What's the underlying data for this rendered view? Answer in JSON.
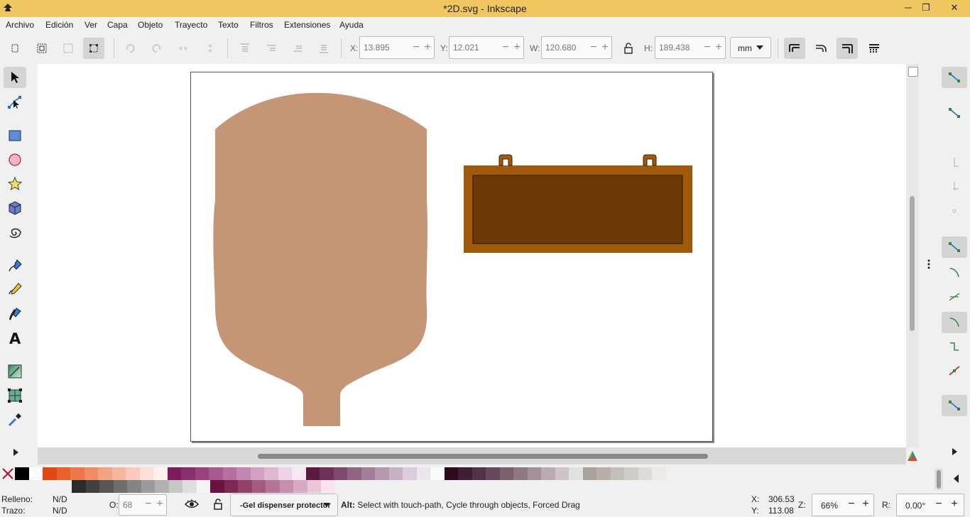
{
  "window": {
    "title": "*2D.svg - Inkscape",
    "minimize": "─",
    "maximize": "❐",
    "close": "✕"
  },
  "menu": [
    "Archivo",
    "Edición",
    "Ver",
    "Capa",
    "Objeto",
    "Trayecto",
    "Texto",
    "Filtros",
    "Extensiones",
    "Ayuda"
  ],
  "toolbar": {
    "x_label": "X:",
    "x_value": "13.895",
    "y_label": "Y:",
    "y_value": "12.021",
    "w_label": "W:",
    "w_value": "120.680",
    "h_label": "H:",
    "h_value": "189.438",
    "unit": "mm"
  },
  "tools": [
    "select-tool",
    "node-tool",
    "rect-tool",
    "circle-tool",
    "star-tool",
    "3dbox-tool",
    "spiral-tool",
    "pen-tool",
    "pencil-tool",
    "calligraphy-tool",
    "text-tool",
    "gradient-tool",
    "mesh-tool",
    "dropper-tool"
  ],
  "canvas": {
    "colors": {
      "bottle": "#c49675",
      "frame": "#a05a0a",
      "panel": "#6b3a07",
      "ring": "#a05a0a"
    }
  },
  "palette": {
    "row1": [
      "#000000",
      "#ffffff",
      "#e04a12",
      "#e8602a",
      "#ec7748",
      "#f08d65",
      "#f3a283",
      "#f6b6a0",
      "#f9cabd",
      "#fcdfd6",
      "#fff1ec",
      "#7e1a5e",
      "#8c2d6e",
      "#9b427e",
      "#a9588f",
      "#b76fa0",
      "#c487b1",
      "#d2a0c2",
      "#dfb9d4",
      "#ecd3e5",
      "#f6e9f2",
      "#5c1a42",
      "#6e3158",
      "#7f4a6d",
      "#916483",
      "#a37e99",
      "#b598ae",
      "#c7b2c4",
      "#d9cdd9",
      "#ebe6ee",
      "#fbf8fb",
      "#2d0a20",
      "#3f1d33",
      "#523246",
      "#66485a",
      "#7a5f6f",
      "#8f7785",
      "#a4909c",
      "#b9aab3",
      "#cec5cb",
      "#e3e0e2",
      "#a9a29b",
      "#b7b0aa",
      "#c4beb8",
      "#d2ccc7",
      "#dfdbd6",
      "#ece9e6"
    ],
    "row2": [
      "#2b2b2b",
      "#414141",
      "#575757",
      "#6e6e6e",
      "#848484",
      "#9b9b9b",
      "#b1b1b1",
      "#c7c7c7",
      "#dedede",
      "#f4f4f4",
      "#6a1240",
      "#7d2954",
      "#904268",
      "#a35b7e",
      "#b67594",
      "#c88fab",
      "#da aac2",
      "#ebc6d9",
      "#f7e4ee"
    ]
  },
  "status": {
    "fill_label": "Relleno:",
    "fill_value": "N/D",
    "stroke_label": "Trazo:",
    "stroke_value": "N/D",
    "opacity_label": "O:",
    "opacity_value": "68",
    "layer": "-Gel dispenser protector",
    "message_bold": "Alt:",
    "message": " Select with touch-path, Cycle through objects, Forced Drag",
    "x_label": "X:",
    "x_value": "306.53",
    "y_label": "Y:",
    "y_value": "113.08",
    "zoom_label": "Z:",
    "zoom_value": "66%",
    "rot_label": "R:",
    "rot_value": "0.00°"
  }
}
